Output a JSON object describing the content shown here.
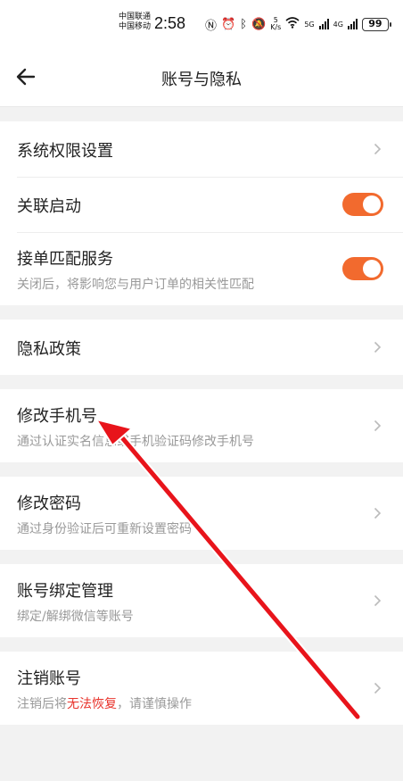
{
  "status_bar": {
    "carrier1": "中国联通",
    "carrier2": "中国移动",
    "time": "2:58",
    "speed_value": "5",
    "speed_unit": "K/s",
    "net1": "5G",
    "net2": "4G",
    "battery": "99"
  },
  "header": {
    "title": "账号与隐私"
  },
  "settings": {
    "permissions": {
      "label": "系统权限设置"
    },
    "linked_start": {
      "label": "关联启动",
      "enabled": true
    },
    "order_matching": {
      "label": "接单匹配服务",
      "desc": "关闭后，将影响您与用户订单的相关性匹配",
      "enabled": true
    },
    "privacy_policy": {
      "label": "隐私政策"
    },
    "change_phone": {
      "label": "修改手机号",
      "desc": "通过认证实名信息或手机验证码修改手机号"
    },
    "change_password": {
      "label": "修改密码",
      "desc": "通过身份验证后可重新设置密码"
    },
    "account_binding": {
      "label": "账号绑定管理",
      "desc": "绑定/解绑微信等账号"
    },
    "delete_account": {
      "label": "注销账号",
      "desc_prefix": "注销后将",
      "desc_warning": "无法恢复",
      "desc_suffix": "，请谨慎操作"
    }
  },
  "colors": {
    "accent": "#f26a2e",
    "warning": "#e8342c",
    "annotation_arrow": "#e8141b"
  }
}
